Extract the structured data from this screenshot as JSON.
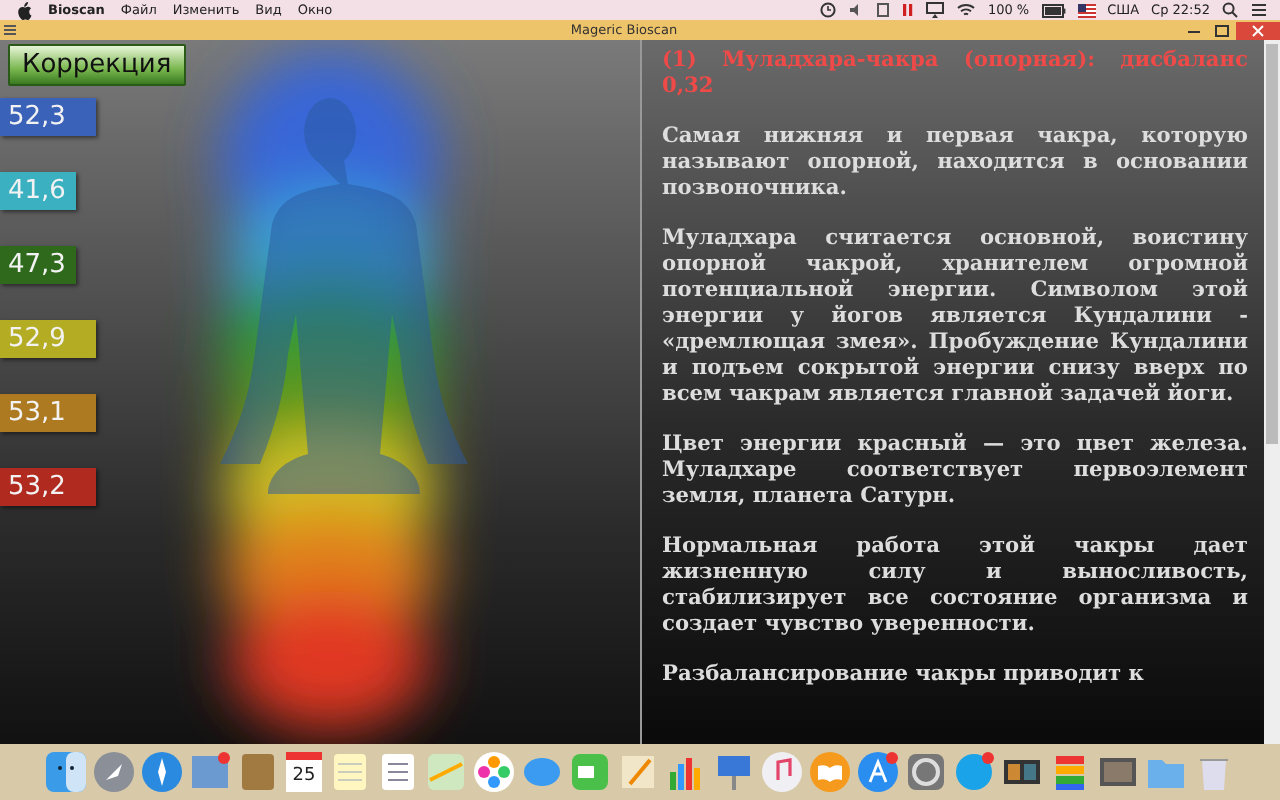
{
  "menu_bar": {
    "app": "Bioscan",
    "items": [
      "Файл",
      "Изменить",
      "Вид",
      "Окно"
    ],
    "battery": "100 %",
    "input_source": "США",
    "clock": "Ср 22:52"
  },
  "window": {
    "title": "Mageric Bioscan"
  },
  "correction_button": {
    "label": "Коррекция"
  },
  "readings": [
    {
      "value": "52,3",
      "color": "#3a62b8"
    },
    {
      "value": "41,6",
      "color": "#3ab0c0"
    },
    {
      "value": "47,3",
      "color": "#2f6a1c"
    },
    {
      "value": "52,9",
      "color": "#b4ac22"
    },
    {
      "value": "53,1",
      "color": "#ad7a22"
    },
    {
      "value": "53,2",
      "color": "#b02a20"
    }
  ],
  "article": {
    "heading": "(1) Муладхара-чакра (опорная): дисбаланс 0,32",
    "paragraphs": [
      "Самая нижняя и первая чакра, которую называют опорной, находится в основании позвоночника.",
      "Муладхара считается основной, воистину опорной чакрой, хранителем огромной потенциальной энергии. Символом этой энергии у йогов является Кундалини - «дремлющая змея». Пробуждение Кундалини и подъем сокрытой энергии снизу вверх по всем чакрам является главной задачей йоги.",
      "Цвет энергии красный — это цвет железа. Муладхаре соответствует первоэлемент земля, планета Сатурн.",
      "Нормальная работа этой чакры дает жизненную силу и выносливость, стабилизирует все состояние организма и создает чувство уверенности.",
      "Разбалансирование чакры приводит к"
    ]
  },
  "dock": {
    "calendar_day": "25"
  }
}
